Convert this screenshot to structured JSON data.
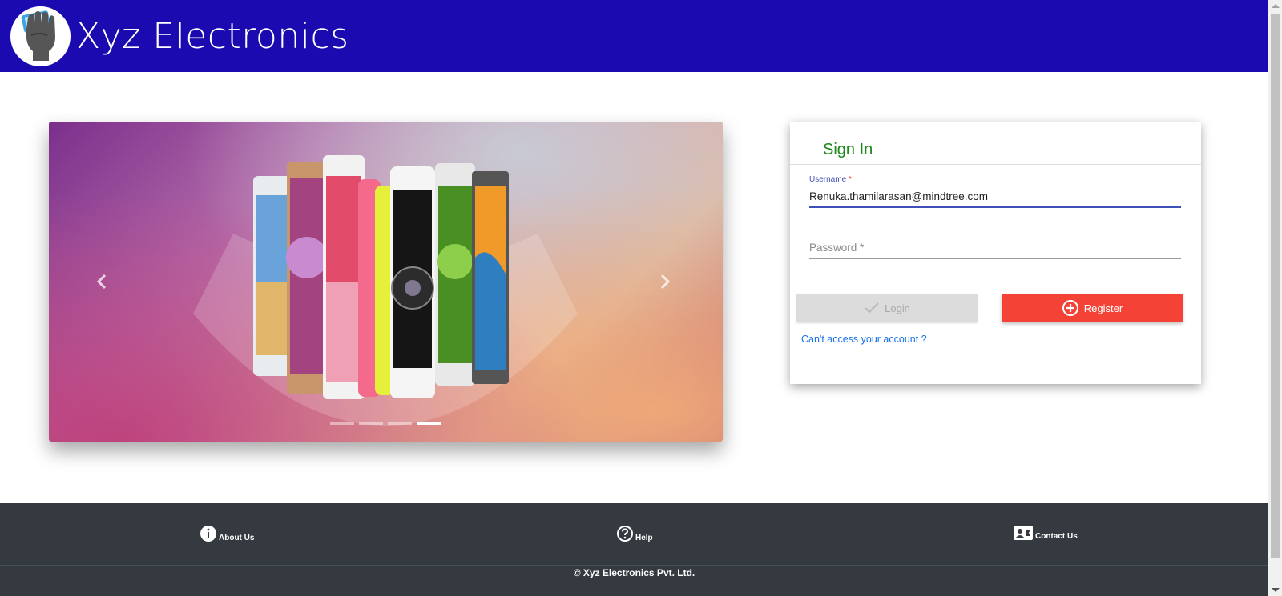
{
  "header": {
    "brand": "Xyz Electronics",
    "background": "#1b0ab0"
  },
  "carousel": {
    "prev_icon": "chevron-left-icon",
    "next_icon": "chevron-right-icon",
    "slide_count": 4,
    "active_index": 3
  },
  "signin": {
    "title": "Sign In",
    "username_label": "Username",
    "required_mark": "*",
    "username_value": "Renuka.thamilarasan@mindtree.com",
    "password_placeholder": "Password *",
    "login_label": "Login",
    "register_label": "Register",
    "forgot_link": "Can't access your account ?",
    "colors": {
      "title": "#1a8a1a",
      "accent": "#3f51b5",
      "register": "#f44336",
      "login_disabled": "#dcdcdc",
      "link": "#1a73e8"
    }
  },
  "footer": {
    "about": "About Us",
    "help": "Help",
    "contact": "Contact Us",
    "copyright": "© Xyz Electronics Pvt. Ltd.",
    "background": "#343a40"
  }
}
